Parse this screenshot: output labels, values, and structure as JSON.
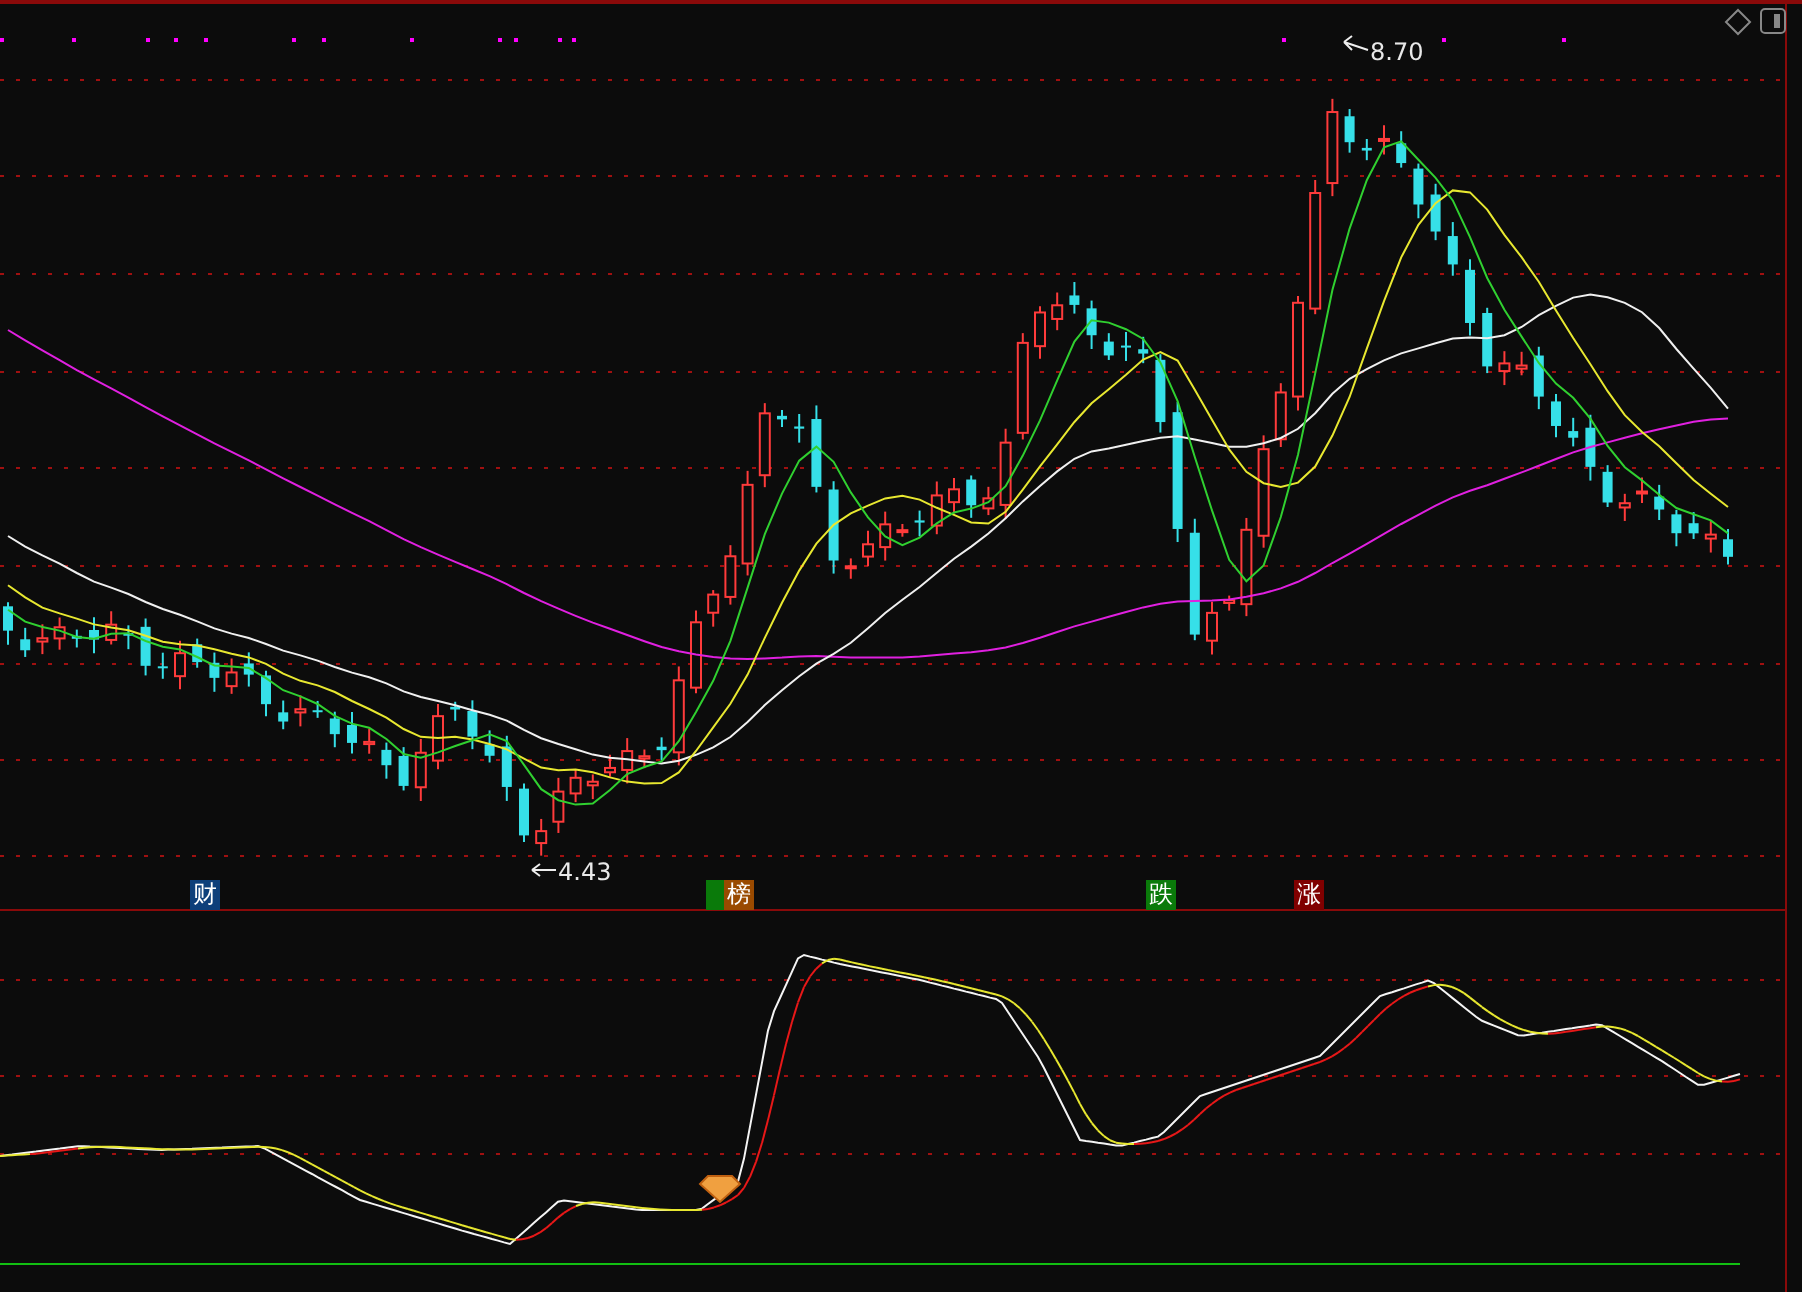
{
  "price_labels": {
    "high": "8.70",
    "low": "4.43"
  },
  "tags": [
    {
      "text": "财",
      "color": "#0d3f7a"
    },
    {
      "text": "榜",
      "color": "#9a4a00"
    },
    {
      "text": "跌",
      "color": "#0a7a0a"
    },
    {
      "text": "涨",
      "color": "#800000"
    }
  ]
}
